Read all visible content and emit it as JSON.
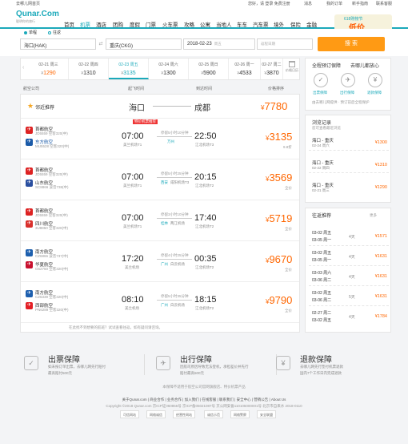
{
  "topbar": {
    "left": "去哪儿网首页",
    "hello": "您好，请 登录 免费注册",
    "msg": "消息",
    "order": "我的订单",
    "guide": "新手指南",
    "contact": "联系客服"
  },
  "logo": {
    "name": "Qunar.Com",
    "slogan": "聪明你的旅行"
  },
  "nav": [
    {
      "label": "首页"
    },
    {
      "label": "机票"
    },
    {
      "label": "酒店"
    },
    {
      "label": "团购"
    },
    {
      "label": "度假"
    },
    {
      "label": "门票"
    },
    {
      "label": "火车票"
    },
    {
      "label": "攻略"
    },
    {
      "label": "公寓"
    },
    {
      "label": "当地人"
    },
    {
      "label": "车车"
    },
    {
      "label": "汽车票"
    },
    {
      "label": "境外"
    },
    {
      "label": "保险"
    },
    {
      "label": "金融"
    }
  ],
  "promo": {
    "line1": "618购物节",
    "line2": "低价"
  },
  "search": {
    "oneway": "单程",
    "roundtrip": "往返",
    "from": "海口(HAK)",
    "to": "重庆(CKG)",
    "date": "2018-02-23",
    "date_day": "周五",
    "return_placeholder": "返程日期",
    "button": "搜 索"
  },
  "dates": [
    {
      "date": "02-21 周三",
      "price": "1290"
    },
    {
      "date": "02-22 周四",
      "price": "1310"
    },
    {
      "date": "02-23 周五",
      "price": "3135"
    },
    {
      "date": "02-24 周六",
      "price": "1300"
    },
    {
      "date": "02-25 周日",
      "price": "5900"
    },
    {
      "date": "02-26 周一",
      "price": "4533"
    },
    {
      "date": "02-27 周二",
      "price": "3870"
    }
  ],
  "cal_label": "价格日历",
  "sort": {
    "airline": "起飞时间",
    "arr": "到达时间",
    "price": "价格排序",
    "filter": "航空公司"
  },
  "recommend": {
    "label": "邻近推荐",
    "from": "海口",
    "to": "成都",
    "price": "7780"
  },
  "flights": [
    {
      "tag": "",
      "a1": "首都航空",
      "n1": "JD5559 空客320(中)",
      "a2": "东方航空",
      "n2": "MU5528 空客320(中)",
      "dep": "07:00",
      "dep_ap": "美兰机场T1",
      "stop": "停留5小时10分钟",
      "city": "万州",
      "stop_ap": "",
      "stop2": "",
      "arr": "22:50",
      "arr_ap": "江北机场T3",
      "price": "3135",
      "disc": "9.8折"
    },
    {
      "tag": "",
      "a1": "首都航空",
      "n1": "JD5559 空客320(中)",
      "a2": "山东航空",
      "n2": "SC8866 波音738(中)",
      "dep": "07:00",
      "dep_ap": "美兰机场T1",
      "stop": "停留5小时25分钟",
      "city": "西安",
      "stop_ap": "咸阳机场T3",
      "stop2": "",
      "arr": "20:15",
      "arr_ap": "江北机场T2",
      "price": "3569",
      "disc": "全价"
    },
    {
      "tag": "",
      "a1": "首都航空",
      "n1": "JD5559 空客320(中)",
      "a2": "四川航空",
      "n2": "3U8850 空客320(中)",
      "dep": "07:00",
      "dep_ap": "美兰机场T1",
      "stop": "停留3小时10分钟",
      "city": "桂林",
      "stop_ap": "两江机场",
      "stop2": "",
      "arr": "17:40",
      "arr_ap": "江北机场T2",
      "price": "5719",
      "disc": "全价"
    },
    {
      "tag": "",
      "a1": "南方航空",
      "n1": "CZ6866 波音737(中)",
      "a2": "华夏航空",
      "n2": "G52750 空客320(中)",
      "dep": "17:20",
      "dep_ap": "美兰机场",
      "stop": "停留4小时25分钟",
      "city": "广州",
      "stop_ap": "白云机场",
      "stop2": "",
      "arr": "00:35",
      "arr_ap": "江北机场T2",
      "price": "9670",
      "disc": "全价"
    },
    {
      "tag": "",
      "a1": "南方航空",
      "n1": "CZ6339 空客320(中)",
      "a2": "西部航空",
      "n2": "PN6289 空客320(中)",
      "dep": "08:10",
      "dep_ap": "美兰机场",
      "stop": "停留5小时35分钟",
      "city": "广州",
      "stop_ap": "白云机场",
      "stop2": "",
      "arr": "18:15",
      "arr_ap": "江北机场T2",
      "price": "9790",
      "disc": "全价"
    }
  ],
  "special_tag": "特价机票推荐",
  "list_note": "在此找不到想要的航班？试试查看往返，如有疑问请咨询。",
  "guarantee": {
    "title": "全程预订保障",
    "title2": "去哪儿都放心",
    "items": [
      "出票保障",
      "出行保障",
      "退款保障"
    ],
    "sub": "由去哪儿网提供 · 预订前后全程保护"
  },
  "history": {
    "title": "浏览记录",
    "sub": "您可查看最近浏览",
    "items": [
      {
        "route": "海口 - 重庆",
        "date": "02-24 周六",
        "price": "1300"
      },
      {
        "route": "海口 - 重庆",
        "date": "02-22 周四",
        "price": "1310"
      },
      {
        "route": "海口 - 重庆",
        "date": "02-21 周三",
        "price": "1290"
      }
    ]
  },
  "roundtrip": {
    "title": "往返推荐",
    "more": "更多",
    "items": [
      {
        "d1": "03-02 周五",
        "d2": "03-05 周一",
        "city": "4天",
        "price": "1571"
      },
      {
        "d1": "03-02 周五",
        "d2": "03-05 周一",
        "city": "4天",
        "price": "1631"
      },
      {
        "d1": "03-03 周六",
        "d2": "03-06 周二",
        "city": "4天",
        "price": "1631"
      },
      {
        "d1": "03-02 周五",
        "d2": "03-06 周二",
        "city": "5天",
        "price": "1631"
      },
      {
        "d1": "02-27 周二",
        "d2": "03-02 周五",
        "city": "4天",
        "price": "1784"
      }
    ]
  },
  "footer": {
    "b1": {
      "title": "出票保障",
      "l1": "如未按订单出票，去哪儿网先行赔付",
      "l2": "最高赔付500元"
    },
    "b2": {
      "title": "出行保障",
      "l1": "因航司原因导致无法登机，承担差价并先行",
      "l2": "赔付最高500元"
    },
    "b3": {
      "title": "退款保障",
      "l1": "去哪儿网先行垫付机票退款",
      "l2": "国内7个工作日内完成退款"
    },
    "note": "本保障不适用于航空公司官网旗舰店、特价机票产品",
    "links": "关于Qunar.com | 商业合作 | 业务合作 | 加入我们 | 在线客服 | 联系我们 | 安全中心 | 营销公告 | About Us",
    "copy": "Copyright ©2018 Qunar.com  京ICP证060856号  京ICP备05021087号  京公网安备110105000001号  北京市自来水 2018-0110",
    "badges": [
      "可信网站",
      "网络诚信",
      "经营性网站",
      "诚信示范",
      "网络警察",
      "安全联盟"
    ]
  }
}
